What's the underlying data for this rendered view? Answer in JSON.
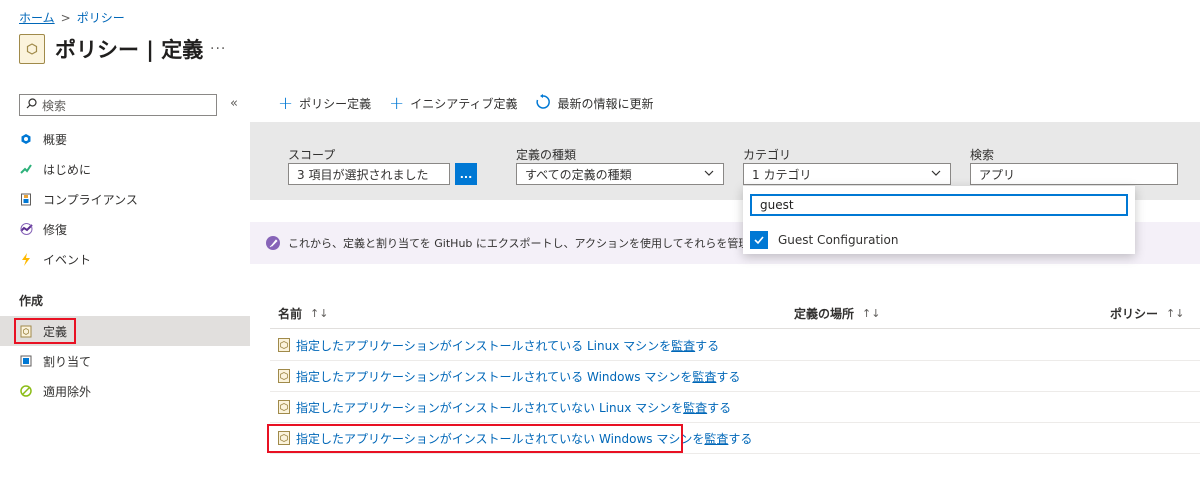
{
  "breadcrumb": {
    "home": "ホーム",
    "policy": "ポリシー",
    "sep": ">"
  },
  "page": {
    "title": "ポリシー | 定義",
    "more": "···"
  },
  "sidebar": {
    "search_placeholder": "検索",
    "collapse": "«",
    "items": [
      {
        "label": "概要",
        "icon": "overview-icon"
      },
      {
        "label": "はじめに",
        "icon": "getting-started-icon"
      },
      {
        "label": "コンプライアンス",
        "icon": "compliance-icon"
      },
      {
        "label": "修復",
        "icon": "remediation-icon"
      },
      {
        "label": "イベント",
        "icon": "events-icon"
      }
    ],
    "section": "作成",
    "authoring": [
      {
        "label": "定義",
        "icon": "definition-icon",
        "selected": true
      },
      {
        "label": "割り当て",
        "icon": "assignment-icon"
      },
      {
        "label": "適用除外",
        "icon": "exemption-icon"
      }
    ]
  },
  "toolbar": {
    "policy_def": "ポリシー定義",
    "initiative_def": "イニシアティブ定義",
    "refresh": "最新の情報に更新"
  },
  "filters": {
    "scope_label": "スコープ",
    "scope_value": "3 項目が選択されました",
    "scope_btn": "...",
    "type_label": "定義の種類",
    "type_value": "すべての定義の種類",
    "category_label": "カテゴリ",
    "category_value": "1 カテゴリ",
    "search_label": "検索",
    "search_value": "アプリ"
  },
  "dropdown": {
    "search_value": "guest",
    "option": "Guest Configuration",
    "checked": true
  },
  "info_bar": {
    "text": "これから、定義と割り当てを GitHub にエクスポートし、アクションを使用してそれらを管理します。[定義の"
  },
  "table": {
    "columns": [
      "名前",
      "定義の場所",
      "ポリシー"
    ],
    "sort_glyph": "↑↓",
    "rows": [
      {
        "prefix": "指定したアプリケーションがインストールされている Linux マシンを",
        "link": "監査",
        "suffix": "する"
      },
      {
        "prefix": "指定したアプリケーションがインストールされている Windows マシンを",
        "link": "監査",
        "suffix": "する"
      },
      {
        "prefix": "指定したアプリケーションがインストールされていない Linux マシンを",
        "link": "監査",
        "suffix": "する"
      },
      {
        "prefix": "指定したアプリケーションがインストールされていない Windows マシンを",
        "link": "監査",
        "suffix": "する"
      }
    ]
  },
  "colors": {
    "accent": "#0078d4",
    "highlight": "#e81123",
    "link": "#0067b8"
  }
}
